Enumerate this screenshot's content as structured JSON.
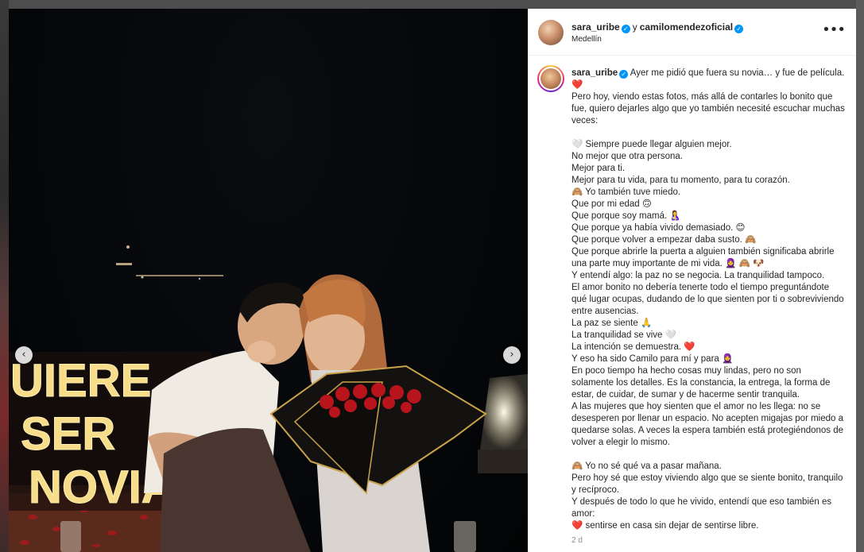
{
  "post": {
    "author": "sara_uribe",
    "conjunction": "y",
    "collaborator": "camilomendezoficial",
    "location": "Medellín",
    "more_icon": "more-horizontal-icon",
    "timestamp": "2 d"
  },
  "photo": {
    "sign_words": [
      "UIERE",
      "SER",
      "NOVIA"
    ],
    "prev_icon": "chevron-left-icon",
    "next_icon": "chevron-right-icon"
  },
  "caption": {
    "author": "sara_uribe",
    "lines": [
      "Ayer me pidió que fuera su novia… y fue de película. ❤️",
      "Pero hoy, viendo estas fotos, más allá de contarles lo bonito que fue, quiero dejarles algo que yo también necesité escuchar muchas veces:",
      "",
      "🤍 Siempre puede llegar alguien mejor.",
      "No mejor que otra persona.",
      "Mejor para ti.",
      "Mejor para tu vida, para tu momento, para tu corazón.",
      "🙈 Yo también tuve miedo.",
      "Que por mi edad 🙃",
      "Que porque soy mamá. 🤱",
      "Que porque ya había vivido demasiado. 😊",
      "Que porque volver a empezar daba susto. 🙈",
      "Que porque abrirle la puerta a alguien también significaba abrirle una parte muy importante de mi vida. 🧕 🙈 🐶",
      "Y entendí algo: la paz no se negocia. La tranquilidad tampoco.",
      "El amor bonito no debería tenerte todo el tiempo preguntándote qué lugar ocupas, dudando de lo que sienten por ti o sobreviviendo entre ausencias.",
      "La paz se siente 🙏",
      "La tranquilidad se vive 🤍",
      "La intención se demuestra. ❤️",
      "Y eso ha sido Camilo para mí y para 🧕",
      "En poco tiempo ha hecho cosas muy lindas, pero no son solamente los detalles. Es la constancia, la entrega, la forma de estar, de cuidar, de sumar y de hacerme sentir tranquila.",
      "A las mujeres que hoy sienten que el amor no les llega: no se desesperen por llenar un espacio. No acepten migajas por miedo a quedarse solas. A veces la espera también está protegiéndonos de volver a elegir lo mismo.",
      "",
      "🙈 Yo no sé qué va a pasar mañana.",
      "Pero hoy sé que estoy viviendo algo que se siente bonito, tranquilo y recíproco.",
      "Y después de todo lo que he vivido, entendí que eso también es amor:",
      "❤️ sentirse en casa sin dejar de sentirse libre."
    ]
  },
  "colors": {
    "verified": "#0095f6",
    "text": "#262626",
    "muted": "#8e8e8e",
    "heart": "#e0245e"
  }
}
